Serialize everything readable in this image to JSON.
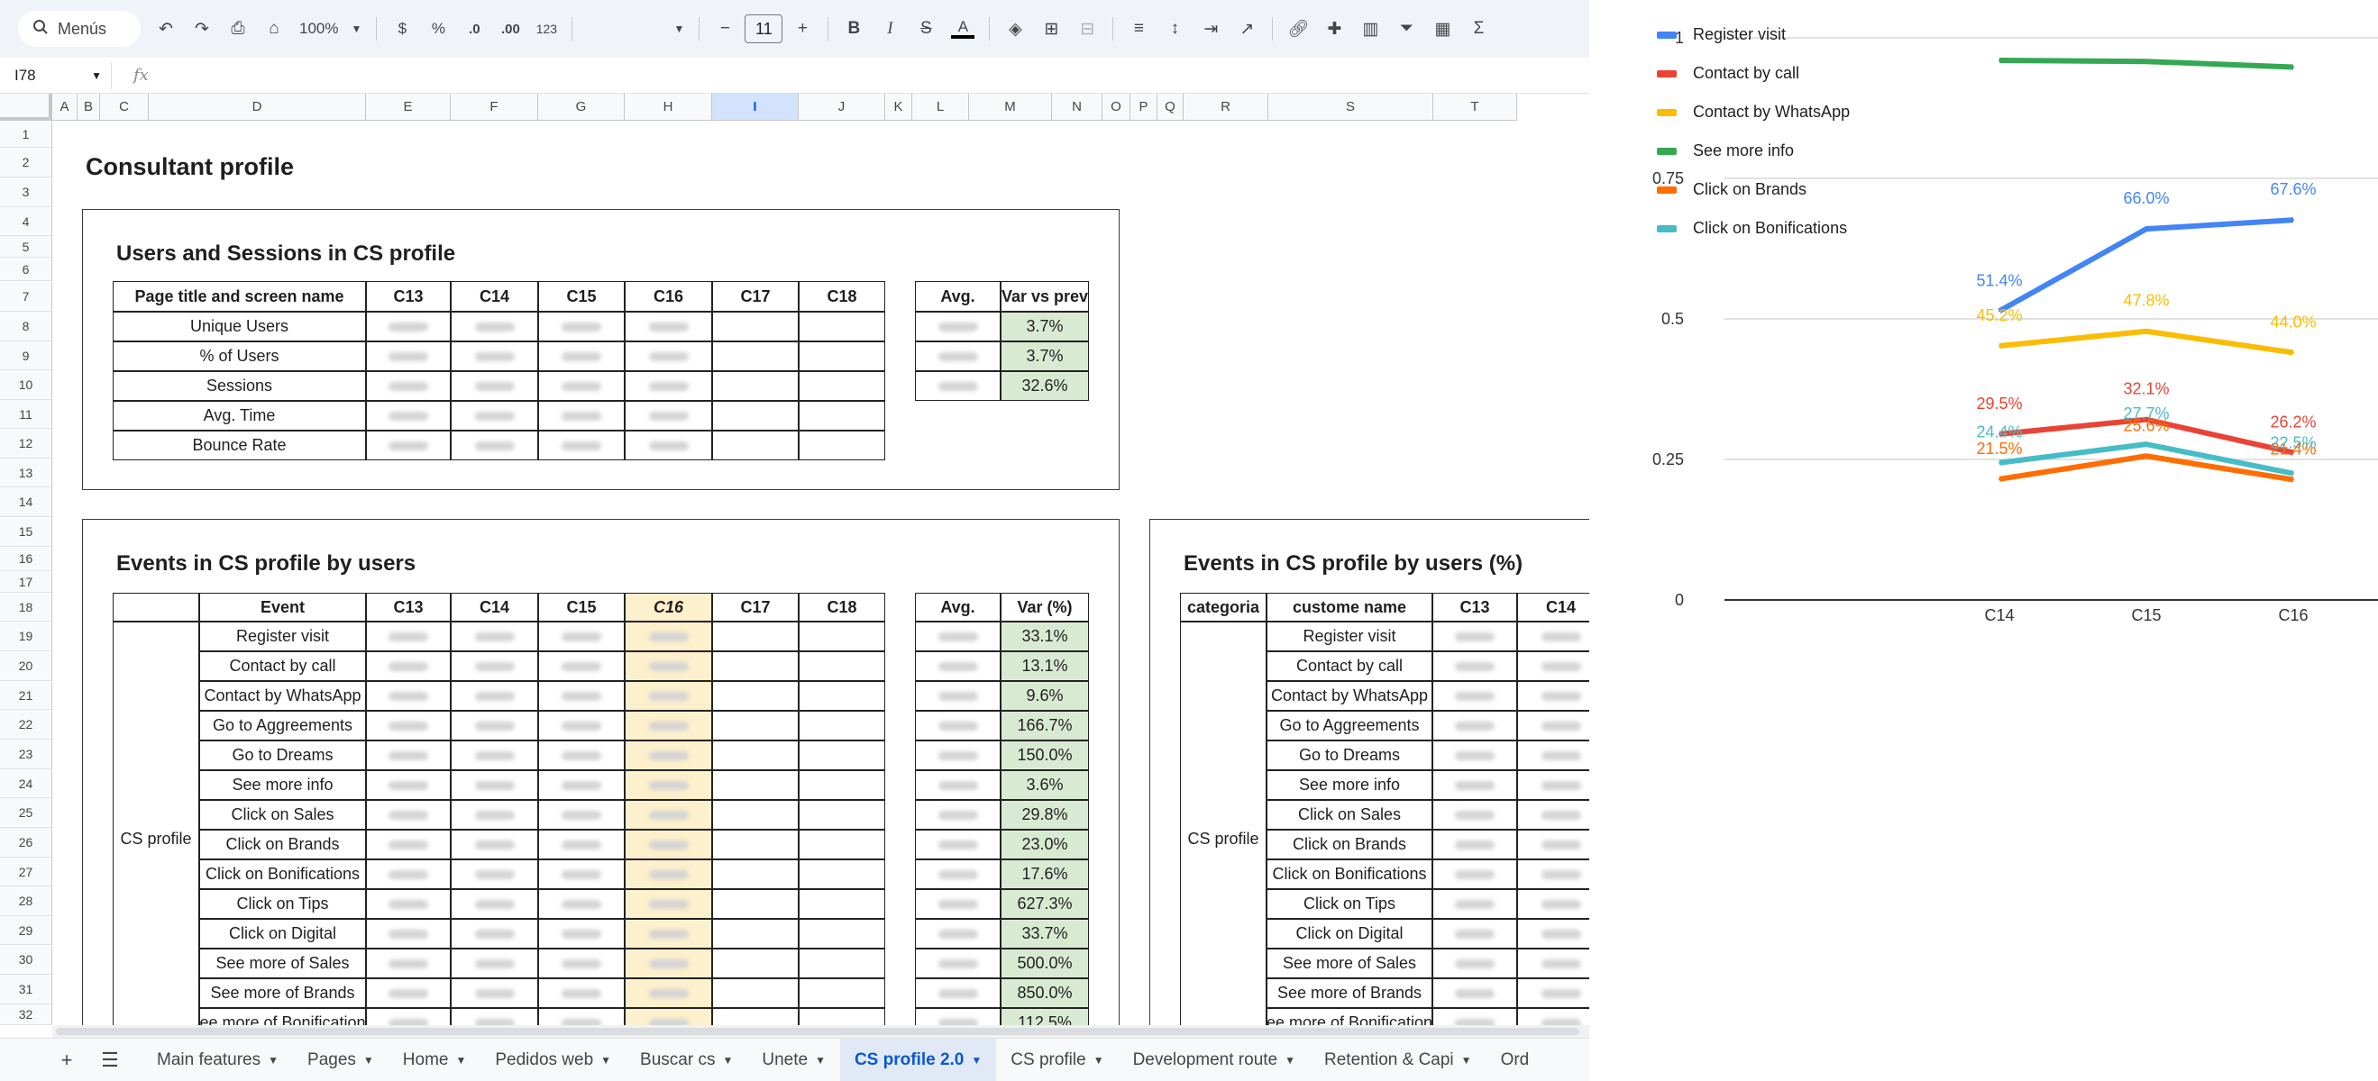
{
  "toolbar": {
    "menus_label": "Menús",
    "zoom": "100%",
    "currency": "$",
    "percent": "%",
    "decimal_decrease": ".0",
    "decimal_increase": ".00",
    "number_format": "123",
    "font_size": "11",
    "bold": "B",
    "italic": "I",
    "strikethrough": "S",
    "text_color": "A",
    "functions": "Σ"
  },
  "formula_bar": {
    "name_box": "I78",
    "fx": "fx",
    "value": ""
  },
  "columns": [
    {
      "letter": "A"
    },
    {
      "letter": "B"
    },
    {
      "letter": "C"
    },
    {
      "letter": "D"
    },
    {
      "letter": "E"
    },
    {
      "letter": "F"
    },
    {
      "letter": "G"
    },
    {
      "letter": "H"
    },
    {
      "letter": "I",
      "selected": true
    },
    {
      "letter": "J"
    },
    {
      "letter": "K"
    },
    {
      "letter": "L"
    },
    {
      "letter": "M"
    },
    {
      "letter": "N"
    },
    {
      "letter": "O"
    },
    {
      "letter": "P"
    },
    {
      "letter": "Q"
    },
    {
      "letter": "R"
    },
    {
      "letter": "S"
    },
    {
      "letter": "T"
    }
  ],
  "row_numbers": [
    "1",
    "2",
    "3",
    "4",
    "5",
    "6",
    "7",
    "8",
    "9",
    "10",
    "11",
    "12",
    "13",
    "14",
    "15",
    "16",
    "17",
    "18",
    "19",
    "20",
    "21",
    "22",
    "23",
    "24",
    "25",
    "26",
    "27",
    "28",
    "29",
    "30",
    "31",
    "32"
  ],
  "sheet": {
    "title": "Consultant profile",
    "users_sessions": {
      "title": "Users and Sessions in CS profile",
      "header": [
        "Page title and screen name",
        "C13",
        "C14",
        "C15",
        "C16",
        "C17",
        "C18"
      ],
      "rows": [
        "Unique Users",
        "% of Users",
        "Sessions",
        "Avg. Time",
        "Bounce Rate"
      ],
      "summary_header": [
        "Avg.",
        "Var vs prev"
      ],
      "var_values": [
        "3.7%",
        "3.7%",
        "32.6%"
      ]
    },
    "events_users": {
      "title": "Events in CS profile by users",
      "header": [
        "Event",
        "C13",
        "C14",
        "C15",
        "C16",
        "C17",
        "C18"
      ],
      "group_label": "CS profile",
      "events": [
        "Register visit",
        "Contact by call",
        "Contact by WhatsApp",
        "Go to Aggreements",
        "Go to Dreams",
        "See more info",
        "Click on Sales",
        "Click on Brands",
        "Click on Bonifications",
        "Click on Tips",
        "Click on Digital",
        "See more of Sales",
        "See more of Brands",
        "ee more of Bonification"
      ],
      "summary_header": [
        "Avg.",
        "Var (%)"
      ],
      "var_values": [
        "33.1%",
        "13.1%",
        "9.6%",
        "166.7%",
        "150.0%",
        "3.6%",
        "29.8%",
        "23.0%",
        "17.6%",
        "627.3%",
        "33.7%",
        "500.0%",
        "850.0%",
        "112.5%"
      ]
    },
    "events_pct": {
      "title": "Events in CS profile by users (%)",
      "header": [
        "categoria",
        "custome name",
        "C13",
        "C14"
      ],
      "group_label": "CS profile",
      "events": [
        "Register visit",
        "Contact by call",
        "Contact by WhatsApp",
        "Go to Aggreements",
        "Go to Dreams",
        "See more info",
        "Click on Sales",
        "Click on Brands",
        "Click on Bonifications",
        "Click on Tips",
        "Click on Digital",
        "See more of Sales",
        "See more of Brands",
        "ee more of Bonification"
      ]
    }
  },
  "tabs": [
    {
      "label": "Main features"
    },
    {
      "label": "Pages"
    },
    {
      "label": "Home"
    },
    {
      "label": "Pedidos web"
    },
    {
      "label": "Buscar cs"
    },
    {
      "label": "Unete"
    },
    {
      "label": "CS profile 2.0",
      "active": true
    },
    {
      "label": "CS profile"
    },
    {
      "label": "Development route"
    },
    {
      "label": "Retention & Capi"
    },
    {
      "label": "Ord"
    }
  ],
  "chart_data": {
    "type": "line",
    "categories": [
      "C14",
      "C15",
      "C16"
    ],
    "ylim": [
      0,
      1
    ],
    "yticks": [
      "0",
      "0.25",
      "0.5",
      "0.75",
      "1"
    ],
    "grid": true,
    "legend_position": "left",
    "series": [
      {
        "name": "Register visit",
        "color": "#4285f4",
        "values": [
          0.514,
          0.66,
          0.676
        ],
        "labels": [
          "51.4%",
          "66.0%",
          "67.6%"
        ]
      },
      {
        "name": "Contact by call",
        "color": "#ea4335",
        "values": [
          0.295,
          0.321,
          0.262
        ],
        "labels": [
          "29.5%",
          "32.1%",
          "26.2%"
        ]
      },
      {
        "name": "Contact by WhatsApp",
        "color": "#fbbc04",
        "values": [
          0.452,
          0.478,
          0.44
        ],
        "labels": [
          "45.2%",
          "47.8%",
          "44.0%"
        ]
      },
      {
        "name": "See more info",
        "color": "#34a853",
        "values": [
          0.96,
          0.958,
          0.948
        ],
        "labels": [
          "",
          "",
          ""
        ]
      },
      {
        "name": "Click on Brands",
        "color": "#ff6d01",
        "values": [
          0.215,
          0.256,
          0.214
        ],
        "labels": [
          "21.5%",
          "25.6%",
          "21.4%"
        ]
      },
      {
        "name": "Click on Bonifications",
        "color": "#46bdc6",
        "values": [
          0.244,
          0.277,
          0.225
        ],
        "labels": [
          "24.4%",
          "27.7%",
          "22.5%"
        ]
      }
    ]
  }
}
